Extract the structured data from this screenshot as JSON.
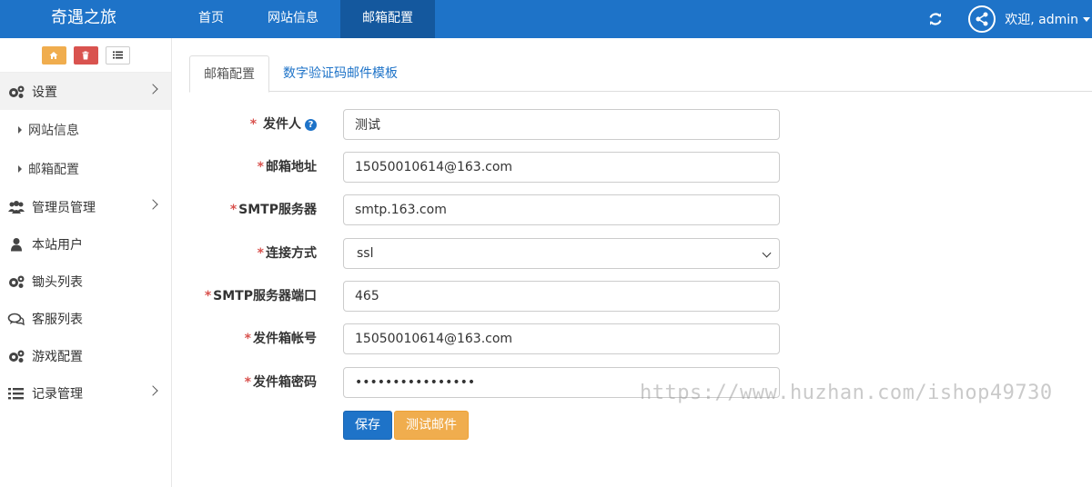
{
  "header": {
    "brand": "奇遇之旅",
    "nav": [
      "首页",
      "网站信息",
      "邮箱配置"
    ],
    "welcome": "欢迎, admin"
  },
  "sidebar": {
    "items": [
      {
        "label": "设置",
        "icon": "gears-icon"
      },
      {
        "label": "网站信息"
      },
      {
        "label": "邮箱配置"
      },
      {
        "label": "管理员管理",
        "icon": "users-icon"
      },
      {
        "label": "本站用户",
        "icon": "user-icon"
      },
      {
        "label": "锄头列表",
        "icon": "gears-icon"
      },
      {
        "label": "客服列表",
        "icon": "chat-icon"
      },
      {
        "label": "游戏配置",
        "icon": "gears-icon"
      },
      {
        "label": "记录管理",
        "icon": "list-icon"
      }
    ]
  },
  "tabs": [
    "邮箱配置",
    "数字验证码邮件模板"
  ],
  "form": {
    "sender": {
      "label": "发件人",
      "value": "测试"
    },
    "email": {
      "label": "邮箱地址",
      "value": "15050010614@163.com"
    },
    "smtp_server": {
      "label": "SMTP服务器",
      "value": "smtp.163.com"
    },
    "connection": {
      "label": "连接方式",
      "value": "ssl"
    },
    "smtp_port": {
      "label": "SMTP服务器端口",
      "value": "465"
    },
    "account": {
      "label": "发件箱帐号",
      "value": "15050010614@163.com"
    },
    "password": {
      "label": "发件箱密码",
      "value": "••••••••••••••••"
    }
  },
  "buttons": {
    "save": "保存",
    "test": "测试邮件"
  },
  "watermark": "https://www.huzhan.com/ishop49730",
  "colors": {
    "primary": "#1e73c8",
    "warning": "#f0ad4e",
    "danger": "#d9534f"
  }
}
